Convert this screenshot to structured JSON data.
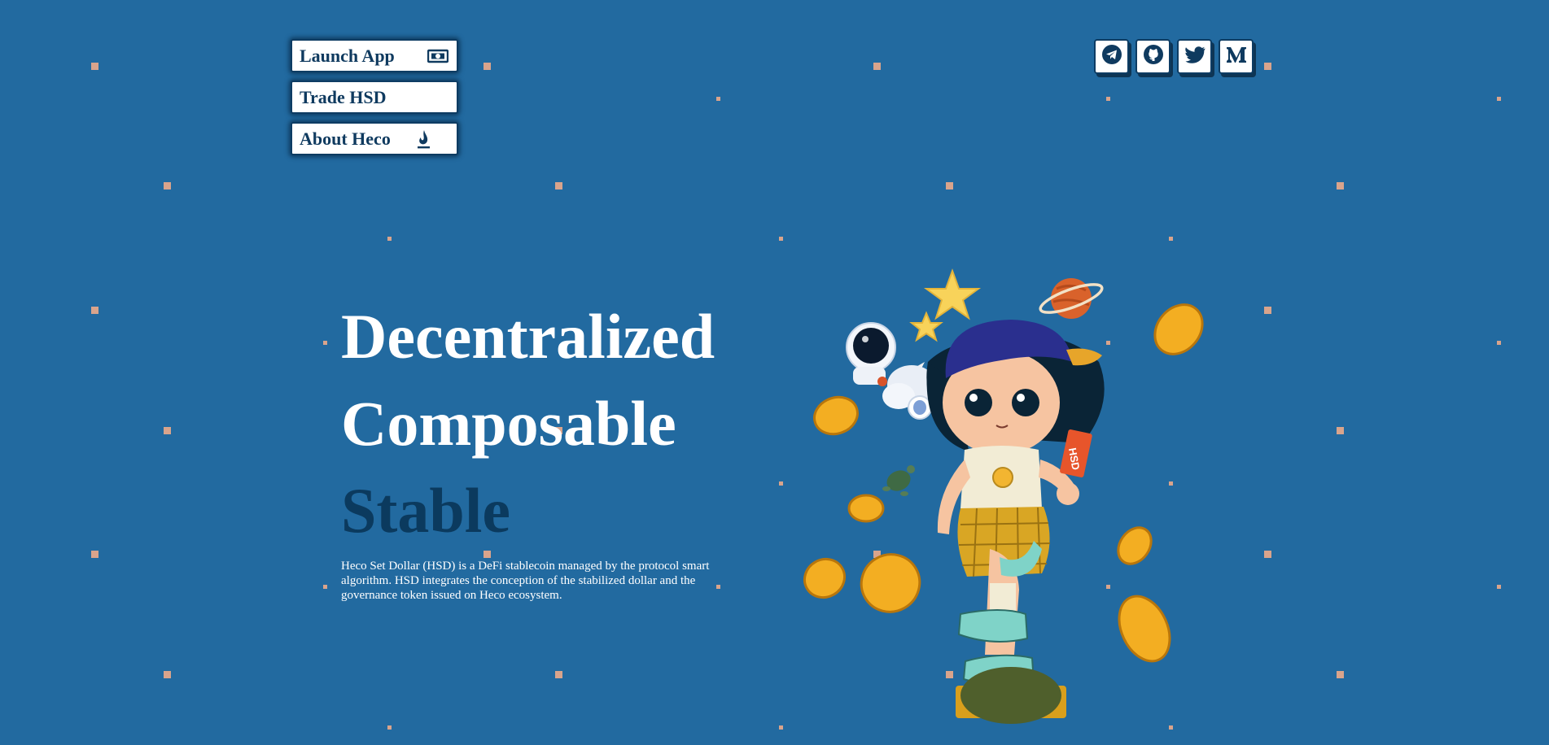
{
  "nav": {
    "launch_label": "Launch App",
    "launch_icon": "cash-icon",
    "trade_label": "Trade HSD",
    "about_label": "About Heco",
    "about_icon": "flame-icon"
  },
  "social": {
    "telegram_icon": "telegram-icon",
    "github_icon": "github-icon",
    "twitter_icon": "twitter-icon",
    "medium_icon": "medium-icon"
  },
  "hero": {
    "line1": "Decentralized",
    "line2": "Composable",
    "line3": "Stable",
    "description": "Heco Set Dollar (HSD) is a DeFi stablecoin managed by the protocol smart algorithm. HSD integrates the conception of the stabilized dollar and the governance token issued on Heco ecosystem.",
    "card_text": "HSD"
  },
  "colors": {
    "background": "#226aa0",
    "accent_text": "#0b3a5e",
    "dots": "#d9a48c",
    "button_border": "#0d3c63"
  }
}
